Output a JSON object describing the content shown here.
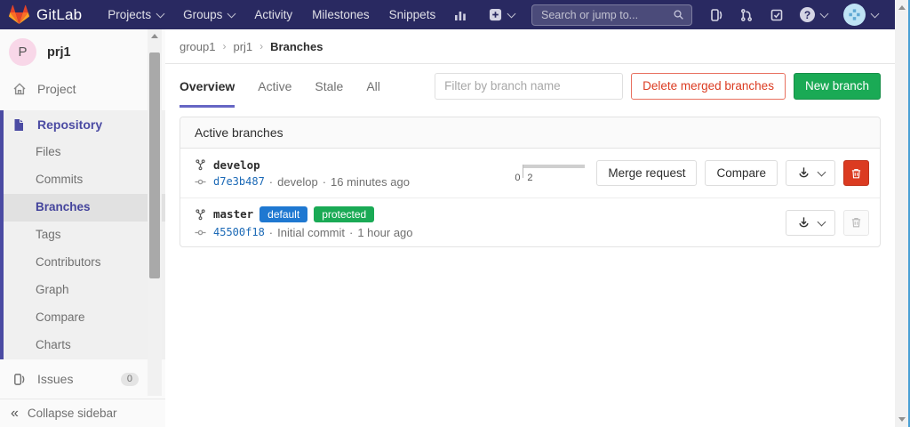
{
  "colors": {
    "navbar_bg": "#292961",
    "accent_purple": "#6666c4",
    "sidebar_active": "#4b4ba3",
    "green": "#1aaa55",
    "badge_blue": "#1f78d1",
    "danger_red": "#db3b21",
    "link_blue": "#1b69b6"
  },
  "navbar": {
    "logo_text": "GitLab",
    "items": [
      {
        "label": "Projects"
      },
      {
        "label": "Groups"
      },
      {
        "label": "Activity"
      },
      {
        "label": "Milestones"
      },
      {
        "label": "Snippets"
      }
    ],
    "search_placeholder": "Search or jump to...",
    "help_glyph": "?"
  },
  "sidebar": {
    "project_initial": "P",
    "project_name": "prj1",
    "project_item": "Project",
    "repository_label": "Repository",
    "repo_subitems": [
      "Files",
      "Commits",
      "Branches",
      "Tags",
      "Contributors",
      "Graph",
      "Compare",
      "Charts"
    ],
    "issues_label": "Issues",
    "issues_count": "0",
    "collapse_icon": "«",
    "collapse_label": "Collapse sidebar"
  },
  "breadcrumb": {
    "group": "group1",
    "project": "prj1",
    "current": "Branches",
    "separator": "›"
  },
  "tabs": {
    "overview": "Overview",
    "active": "Active",
    "stale": "Stale",
    "all": "All"
  },
  "toolbar": {
    "filter_placeholder": "Filter by branch name",
    "delete_merged_label": "Delete merged branches",
    "new_branch_label": "New branch"
  },
  "card": {
    "title": "Active branches",
    "branches": [
      {
        "name": "develop",
        "commit_hash": "d7e3b487",
        "commit_message": "develop",
        "time": "16 minutes ago",
        "behind": "0",
        "ahead": "2",
        "merge_request_label": "Merge request",
        "compare_label": "Compare"
      },
      {
        "name": "master",
        "default_badge": "default",
        "protected_badge": "protected",
        "commit_hash": "45500f18",
        "commit_message": "Initial commit",
        "time": "1 hour ago"
      }
    ]
  },
  "misc": {
    "dot": "·"
  }
}
